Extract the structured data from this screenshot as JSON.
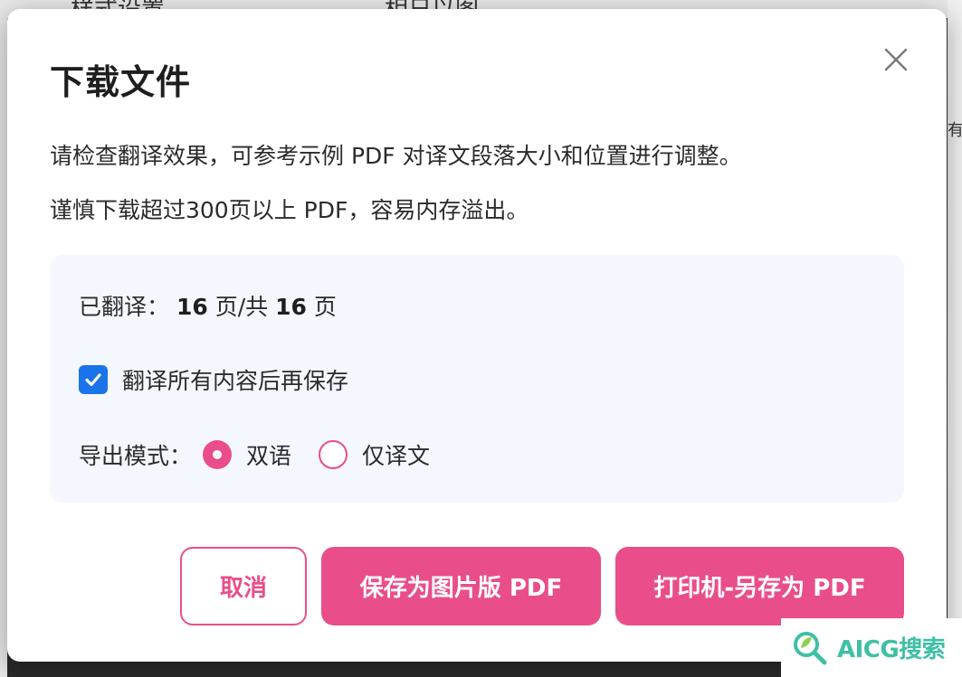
{
  "background": {
    "top_text_left": "样式设置",
    "top_text_mid": "相日以图",
    "right_strip_top": "有"
  },
  "modal": {
    "title": "下载文件",
    "close_icon": "close-icon",
    "description_1": "请检查翻译效果，可参考示例 PDF 对译文段落大小和位置进行调整。",
    "description_2": "谨慎下载超过300页以上 PDF，容易内存溢出。",
    "progress": {
      "label": "已翻译：",
      "done": "16",
      "unit_done": "页/共",
      "total": "16",
      "unit_total": "页"
    },
    "translate_all": {
      "checked": true,
      "label": "翻译所有内容后再保存"
    },
    "export_mode": {
      "label": "导出模式：",
      "options": [
        {
          "label": "双语",
          "selected": true
        },
        {
          "label": "仅译文",
          "selected": false
        }
      ]
    },
    "buttons": {
      "cancel": "取消",
      "save_image_pdf": "保存为图片版 PDF",
      "print_save_pdf": "打印机-另存为 PDF"
    }
  },
  "watermark": {
    "text": "AICG搜索",
    "icon": "magnifier-leaf-icon"
  },
  "colors": {
    "accent": "#e94e8a",
    "checkbox": "#1a73e8",
    "panel_bg": "#f4f7fe",
    "watermark": "#3fbfa4"
  }
}
